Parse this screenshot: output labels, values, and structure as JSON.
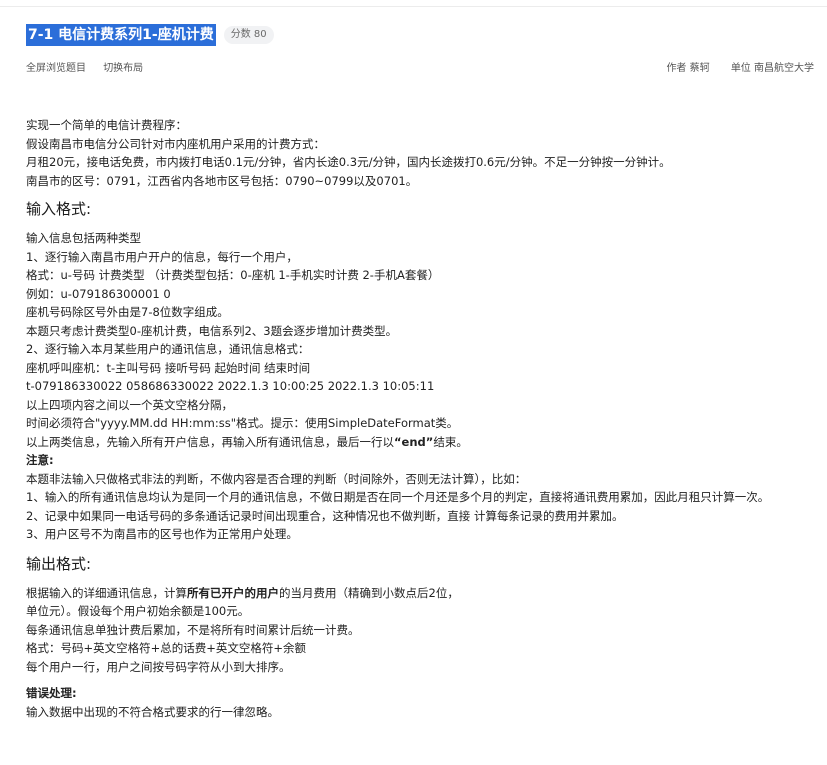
{
  "header": {
    "title": "7-1 电信计费系列1-座机计费",
    "score_badge": "分数 80"
  },
  "toolbar": {
    "fullscreen": "全屏浏览题目",
    "switch_layout": "切换布局",
    "author": "作者 蔡轲",
    "unit": "单位 南昌航空大学"
  },
  "intro": [
    "实现一个简单的电信计费程序：",
    "假设南昌市电信分公司针对市内座机用户采用的计费方式：",
    "月租20元，接电话免费，市内拨打电话0.1元/分钟，省内长途0.3元/分钟，国内长途拨打0.6元/分钟。不足一分钟按一分钟计。",
    "南昌市的区号：0791，江西省内各地市区号包括：0790~0799以及0701。"
  ],
  "input_section": {
    "heading": "输入格式:",
    "lines": [
      "输入信息包括两种类型",
      "1、逐行输入南昌市用户开户的信息，每行一个用户，",
      "格式：u-号码 计费类型 （计费类型包括：0-座机 1-手机实时计费 2-手机A套餐）",
      "例如：u-079186300001 0",
      "座机号码除区号外由是7-8位数字组成。",
      "本题只考虑计费类型0-座机计费，电信系列2、3题会逐步增加计费类型。",
      "2、逐行输入本月某些用户的通讯信息，通讯信息格式：",
      "座机呼叫座机：t-主叫号码 接听号码 起始时间 结束时间",
      "t-079186330022 058686330022 2022.1.3 10:00:25 2022.1.3 10:05:11",
      "以上四项内容之间以一个英文空格分隔，",
      "时间必须符合\"yyyy.MM.dd HH:mm:ss\"格式。提示：使用SimpleDateFormat类。"
    ],
    "end_line_prefix": "以上两类信息，先输入所有开户信息，再输入所有通讯信息，最后一行以",
    "end_line_bold": "“end”",
    "end_line_suffix": "结束。",
    "note_label": "注意:",
    "note_lines": [
      "本题非法输入只做格式非法的判断，不做内容是否合理的判断（时间除外，否则无法计算），比如：",
      "1、输入的所有通讯信息均认为是同一个月的通讯信息，不做日期是否在同一个月还是多个月的判定，直接将通讯费用累加，因此月租只计算一次。",
      "2、记录中如果同一电话号码的多条通话记录时间出现重合，这种情况也不做判断，直接 计算每条记录的费用并累加。",
      "3、用户区号不为南昌市的区号也作为正常用户处理。"
    ]
  },
  "output_section": {
    "heading": "输出格式:",
    "line1_prefix": "根据输入的详细通讯信息，计算",
    "line1_bold": "所有已开户的用户",
    "line1_suffix": "的当月费用（精确到小数点后2位，",
    "lines": [
      "单位元）。假设每个用户初始余额是100元。",
      "每条通讯信息单独计费后累加，不是将所有时间累计后统一计费。",
      "格式：号码+英文空格符+总的话费+英文空格符+余额",
      "每个用户一行，用户之间按号码字符从小到大排序。"
    ],
    "error_label": "错误处理:",
    "error_line": "输入数据中出现的不符合格式要求的行一律忽略。"
  }
}
